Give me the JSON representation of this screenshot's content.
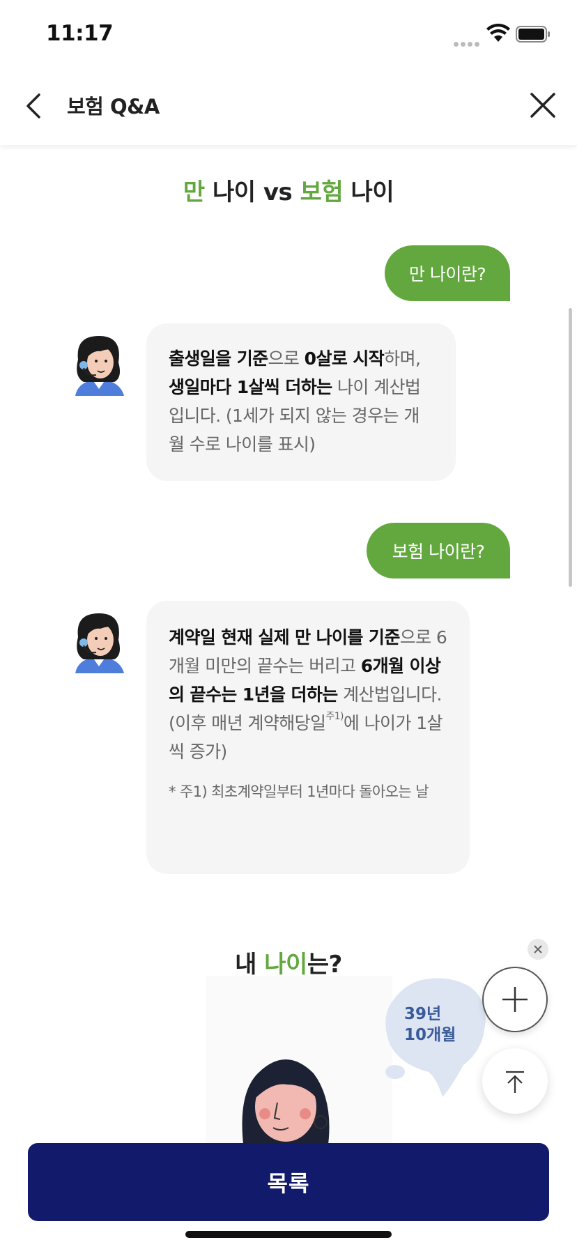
{
  "status_bar": {
    "time": "11:17"
  },
  "header": {
    "title": "보험 Q&A"
  },
  "qa_section": {
    "title_part1": "만",
    "title_part2": " 나이 vs ",
    "title_part3": "보험",
    "title_part4": " 나이",
    "q1": "만 나이란?",
    "a1": {
      "b1": "출생일을 기준",
      "t1": "으로 ",
      "b2": "0살로 시작",
      "t2": "하며, ",
      "b3": "생일마다 1살씩 더하는",
      "t3": " 나이 계산법입니다. (1세가 되지 않는 경우는 개월 수로 나이를 표시)"
    },
    "q2": "보험 나이란?",
    "a2": {
      "b1": "계약일 현재 실제 만 나이를 기준",
      "t1": "으로 6개월 미만의 끝수는 버리고 ",
      "b2": "6개월 이상의 끝수는 1년을 더하는",
      "t2": " 계산법입니다. (이후 매년 계약해당일",
      "sup": "주1)",
      "t3": "에 나이가 1살씩 증가)",
      "footnote": "* 주1) 최초계약일부터 1년마다 돌아오는 날"
    }
  },
  "my_age_section": {
    "title_part1": "내 ",
    "title_part2": "나이",
    "title_part3": "는?",
    "age_line1": "39년",
    "age_line2": "10개월"
  },
  "bottom_button": {
    "label": "목록"
  },
  "colors": {
    "accent_green": "#62a83e",
    "primary_navy": "#111a6b",
    "bubble_gray": "#f5f5f5"
  }
}
